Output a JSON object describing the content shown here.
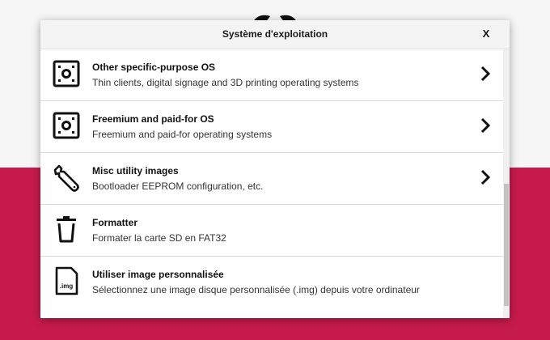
{
  "dialog": {
    "title": "Système d'exploitation",
    "close_label": "X"
  },
  "items": [
    {
      "title": "Other specific-purpose OS",
      "description": "Thin clients, digital signage and 3D printing operating systems",
      "icon": "os-board-icon",
      "has_chevron": true
    },
    {
      "title": "Freemium and paid-for OS",
      "description": "Freemium and paid-for operating systems",
      "icon": "os-board-icon",
      "has_chevron": true
    },
    {
      "title": "Misc utility images",
      "description": "Bootloader EEPROM configuration, etc.",
      "icon": "wrench-icon",
      "has_chevron": true
    },
    {
      "title": "Formatter",
      "description": "Formater la carte SD en FAT32",
      "icon": "trash-icon",
      "has_chevron": false
    },
    {
      "title": "Utiliser image personnalisée",
      "description": "Sélectionnez une image disque personnalisée (.img) depuis votre ordinateur",
      "icon": "img-file-icon",
      "icon_text": ".img",
      "has_chevron": false
    }
  ],
  "colors": {
    "brand_red": "#c51a4a",
    "background_light": "#f6f6f6"
  }
}
